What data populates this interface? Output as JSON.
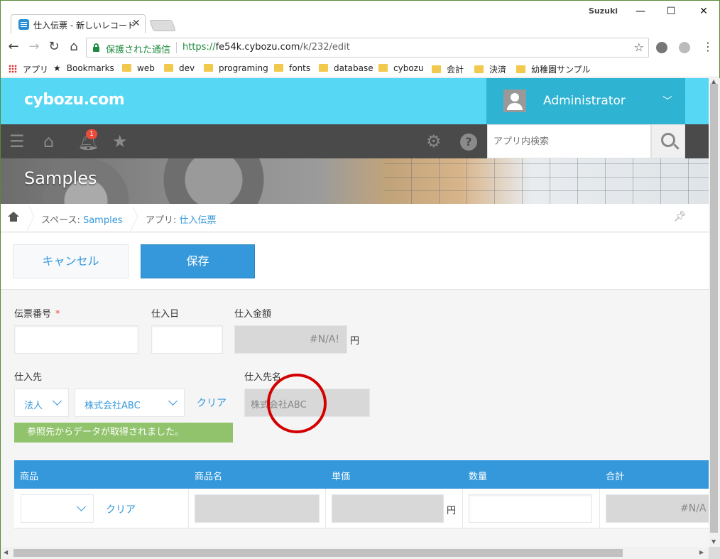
{
  "browser": {
    "tab_title": "仕入伝票 - 新しいレコード",
    "profile_name": "Suzuki",
    "secure_label": "保護された通信",
    "url_scheme": "https://",
    "url_host": "fe54k.cybozu.com",
    "url_path": "/k/232/edit",
    "bookmarks": [
      "アプリ",
      "Bookmarks",
      "web",
      "dev",
      "programing",
      "fonts",
      "database",
      "cybozu",
      "会計",
      "決済",
      "幼稚園サンプル"
    ]
  },
  "header": {
    "logo": "cybozu.com",
    "user": "Administrator"
  },
  "gnav": {
    "notification_count": "1",
    "search_placeholder": "アプリ内検索"
  },
  "banner": {
    "title": "Samples"
  },
  "breadcrumb": {
    "space_prefix": "スペース: ",
    "space": "Samples",
    "app_prefix": "アプリ: ",
    "app": "仕入伝票"
  },
  "actions": {
    "cancel": "キャンセル",
    "save": "保存"
  },
  "form": {
    "slip_no_label": "伝票番号",
    "required_mark": "*",
    "purchase_date_label": "仕入日",
    "amount_label": "仕入金額",
    "amount_value": "#N/A!",
    "yen": "円",
    "supplier_label": "仕入先",
    "supplier_type": "法人",
    "supplier_company": "株式会社ABC",
    "clear": "クリア",
    "supplier_name_label": "仕入先名",
    "supplier_name_value": "株式会社ABC",
    "lookup_notice": "参照先からデータが取得されました。"
  },
  "table": {
    "headers": [
      "商品",
      "商品名",
      "単価",
      "数量",
      "合計"
    ],
    "row": {
      "clear": "クリア",
      "yen": "円",
      "total": "#N/A"
    }
  }
}
